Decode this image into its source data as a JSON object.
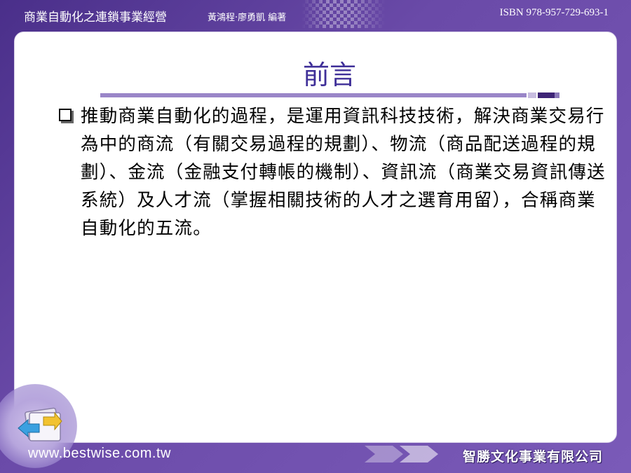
{
  "header": {
    "book_title": "商業自動化之連鎖事業經營",
    "authors": "黃鴻程‧廖勇凱 編著",
    "isbn": "ISBN 978-957-729-693-1"
  },
  "slide": {
    "title": "前言",
    "body": "推動商業自動化的過程，是運用資訊科技技術，解決商業交易行為中的商流（有關交易過程的規劃）、物流（商品配送過程的規劃）、金流（金融支付轉帳的機制）、資訊流（商業交易資訊傳送系統）及人才流（掌握相關技術的人才之選育用留），合稱商業自動化的五流。"
  },
  "footer": {
    "url": "www.bestwise.com.tw",
    "publisher": "智勝文化事業有限公司"
  },
  "colors": {
    "background": "#5a3d9c",
    "title": "#3f2f98",
    "rule": "#9a86c8",
    "accent_dark": "#3e2476"
  },
  "icons": [
    "folder-arrows-icon",
    "checkbox-bullet-icon",
    "double-arrow-icon"
  ]
}
